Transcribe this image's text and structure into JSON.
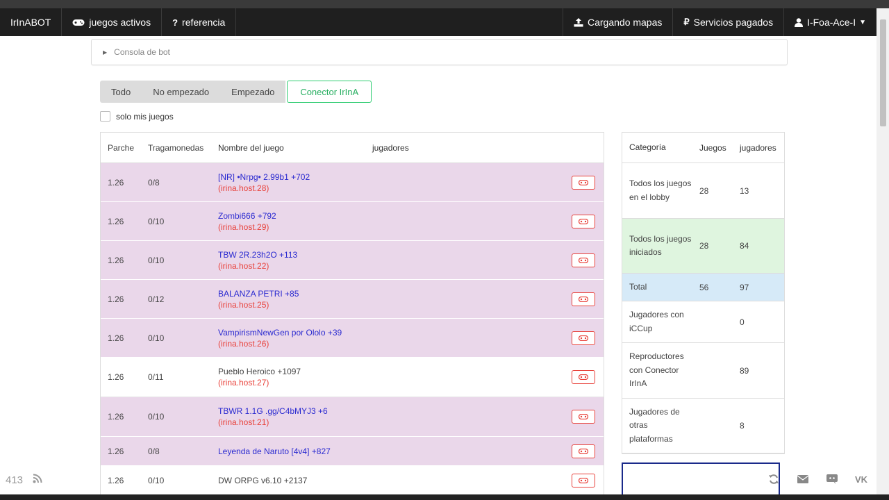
{
  "nav": {
    "brand": "IrInABOT",
    "active_games": "juegos activos",
    "reference": "referencia",
    "loading_maps": "Cargando mapas",
    "paid_services": "Servicios pagados",
    "user": "I-Foa-Ace-I",
    "icons": [
      "gamepad-icon",
      "question-icon",
      "upload-icon",
      "ruble-icon",
      "user-icon"
    ]
  },
  "console": {
    "label": "Consola de bot"
  },
  "filters": {
    "all": "Todo",
    "not_started": "No empezado",
    "started": "Empezado",
    "connector": "Conector IrInA",
    "active_color": "#27ae60"
  },
  "only_mine": {
    "label": "solo mis juegos",
    "checked": false
  },
  "games_table": {
    "headers": {
      "patch": "Parche",
      "slots": "Tragamonedas",
      "name": "Nombre del juego",
      "players": "jugadores"
    },
    "rows": [
      {
        "patch": "1.26",
        "slots": "0/8",
        "name": "[NR] •Nrpg• 2.99b1 +702",
        "host": "(irina.host.28)",
        "style": "pink"
      },
      {
        "patch": "1.26",
        "slots": "0/10",
        "name": "Zombi666 +792",
        "host": "(irina.host.29)",
        "style": "pink"
      },
      {
        "patch": "1.26",
        "slots": "0/10",
        "name": "TBW 2R.23h2O +113",
        "host": "(irina.host.22)",
        "style": "pink"
      },
      {
        "patch": "1.26",
        "slots": "0/12",
        "name": "BALANZA PETRI +85",
        "host": "(irina.host.25)",
        "style": "pink"
      },
      {
        "patch": "1.26",
        "slots": "0/10",
        "name": "VampirismNewGen por Ololo +39",
        "host": "(irina.host.26)",
        "style": "pink"
      },
      {
        "patch": "1.26",
        "slots": "0/11",
        "name": "Pueblo Heroico +1097",
        "host": "(irina.host.27)",
        "style": "white"
      },
      {
        "patch": "1.26",
        "slots": "0/10",
        "name": "TBWR 1.1G .gg/C4bMYJ3 +6",
        "host": "(irina.host.21)",
        "style": "pink"
      },
      {
        "patch": "1.26",
        "slots": "0/8",
        "name": "Leyenda de Naruto [4v4] +827",
        "host": "",
        "style": "pink"
      },
      {
        "patch": "1.26",
        "slots": "0/10",
        "name": "DW ORPG v6.10 +2137",
        "host": "",
        "style": "white"
      }
    ]
  },
  "stats_table": {
    "headers": {
      "category": "Categoría",
      "games": "Juegos",
      "players": "jugadores"
    },
    "rows": [
      {
        "category": "Todos los juegos en el lobby",
        "games": "28",
        "players": "13",
        "style": "white"
      },
      {
        "category": "Todos los juegos iniciados",
        "games": "28",
        "players": "84",
        "style": "green"
      },
      {
        "category": "Total",
        "games": "56",
        "players": "97",
        "style": "blue"
      },
      {
        "category": "Jugadores con iCCup",
        "games": "",
        "players": "0",
        "style": "white"
      },
      {
        "category": "Reproductores con Conector IrInA",
        "games": "",
        "players": "89",
        "style": "white"
      },
      {
        "category": "Jugadores de otras plataformas",
        "games": "",
        "players": "8",
        "style": "white"
      }
    ]
  },
  "footer": {
    "counter": "413",
    "icons": [
      "rss-icon",
      "refresh-icon",
      "mail-icon",
      "discord-icon",
      "vk-icon"
    ]
  },
  "colors": {
    "navbar": "#1f1f1f",
    "pink_row": "#ead7ea",
    "green_row": "#dff5df",
    "blue_row": "#d6eaf8",
    "game_link": "#2a2ad0",
    "host": "#e8413a"
  }
}
